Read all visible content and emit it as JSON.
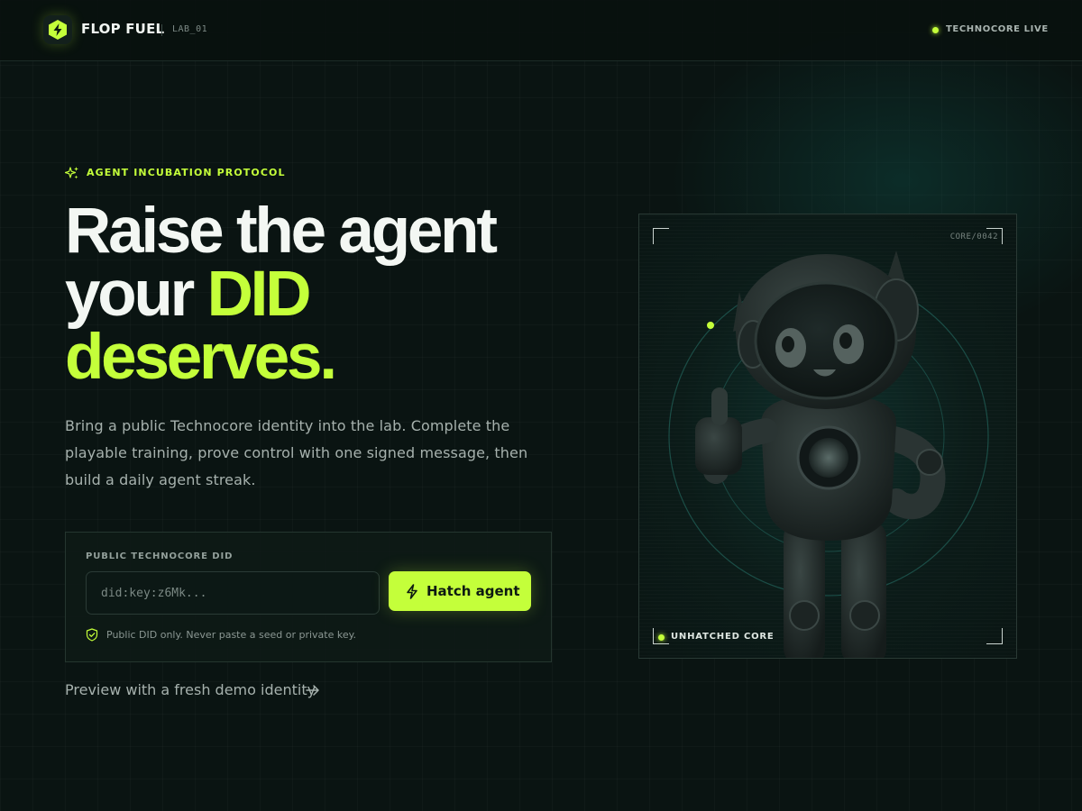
{
  "header": {
    "brand": "FLOP FUEL",
    "lab": "LAB_01",
    "status": "TECHNOCORE LIVE"
  },
  "hero": {
    "eyebrow": "AGENT INCUBATION PROTOCOL",
    "headline": {
      "line1": "Raise the agent",
      "line2_plain": "your ",
      "line2_accent": "DID",
      "line3": "deserves."
    },
    "lead": "Bring a public Technocore identity into the lab. Complete the playable training, prove control with one signed message, then build a daily agent streak."
  },
  "form": {
    "label": "PUBLIC TECHNOCORE DID",
    "input_value": "",
    "input_placeholder": "did:key:z6Mk...",
    "submit_label": "Hatch agent",
    "hint": "Public DID only. Never paste a seed or private key."
  },
  "preview_link": "Preview with a fresh demo identity",
  "panel": {
    "core_id": "CORE/0042",
    "status": "UNHATCHED CORE"
  },
  "icons": {
    "logo": "bolt-hexagon-icon",
    "eyebrow": "sparkles-icon",
    "button": "bolt-icon",
    "hint": "shield-check-icon",
    "link": "arrow-right-icon"
  },
  "colors": {
    "background": "#0a1412",
    "accent": "#c4ff3a",
    "text_primary": "#f3f7f3",
    "text_muted": "#a6b1ad"
  }
}
